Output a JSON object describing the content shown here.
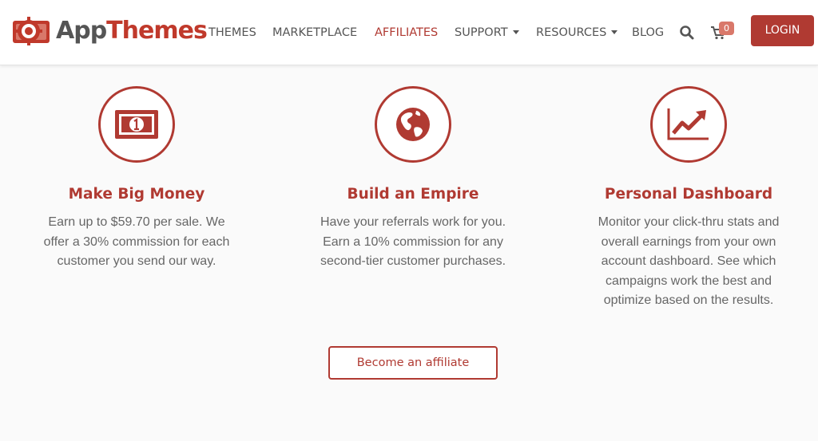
{
  "brand": {
    "name_part1": "App",
    "name_part2": "Themes",
    "primary_color": "#b03a32"
  },
  "nav": {
    "items": [
      {
        "label": "THEMES",
        "dropdown": false,
        "active": false
      },
      {
        "label": "MARKETPLACE",
        "dropdown": false,
        "active": false
      },
      {
        "label": "AFFILIATES",
        "dropdown": false,
        "active": true
      },
      {
        "label": "SUPPORT",
        "dropdown": true,
        "active": false
      },
      {
        "label": "RESOURCES",
        "dropdown": true,
        "active": false
      },
      {
        "label": "BLOG",
        "dropdown": false,
        "active": false
      }
    ],
    "search_icon": "search-icon",
    "cart_icon": "cart-icon",
    "cart_count": "0",
    "login_label": "LOGIN"
  },
  "features": [
    {
      "icon": "money-bill-icon",
      "title": "Make Big Money",
      "lines": [
        "Earn up to $59.70 per sale. We",
        "offer a 30% commission for each",
        "customer you send our way."
      ]
    },
    {
      "icon": "globe-icon",
      "title": "Build an Empire",
      "lines": [
        "Have your referrals work for you.",
        "Earn a 10% commission for any",
        "second-tier customer purchases."
      ]
    },
    {
      "icon": "trending-chart-icon",
      "title": "Personal Dashboard",
      "lines": [
        "Monitor your click-thru stats and",
        "overall earnings from your own",
        "account dashboard. See which",
        "campaigns work the best and",
        "optimize based on the results."
      ]
    }
  ],
  "cta": {
    "label": "Become an affiliate"
  }
}
